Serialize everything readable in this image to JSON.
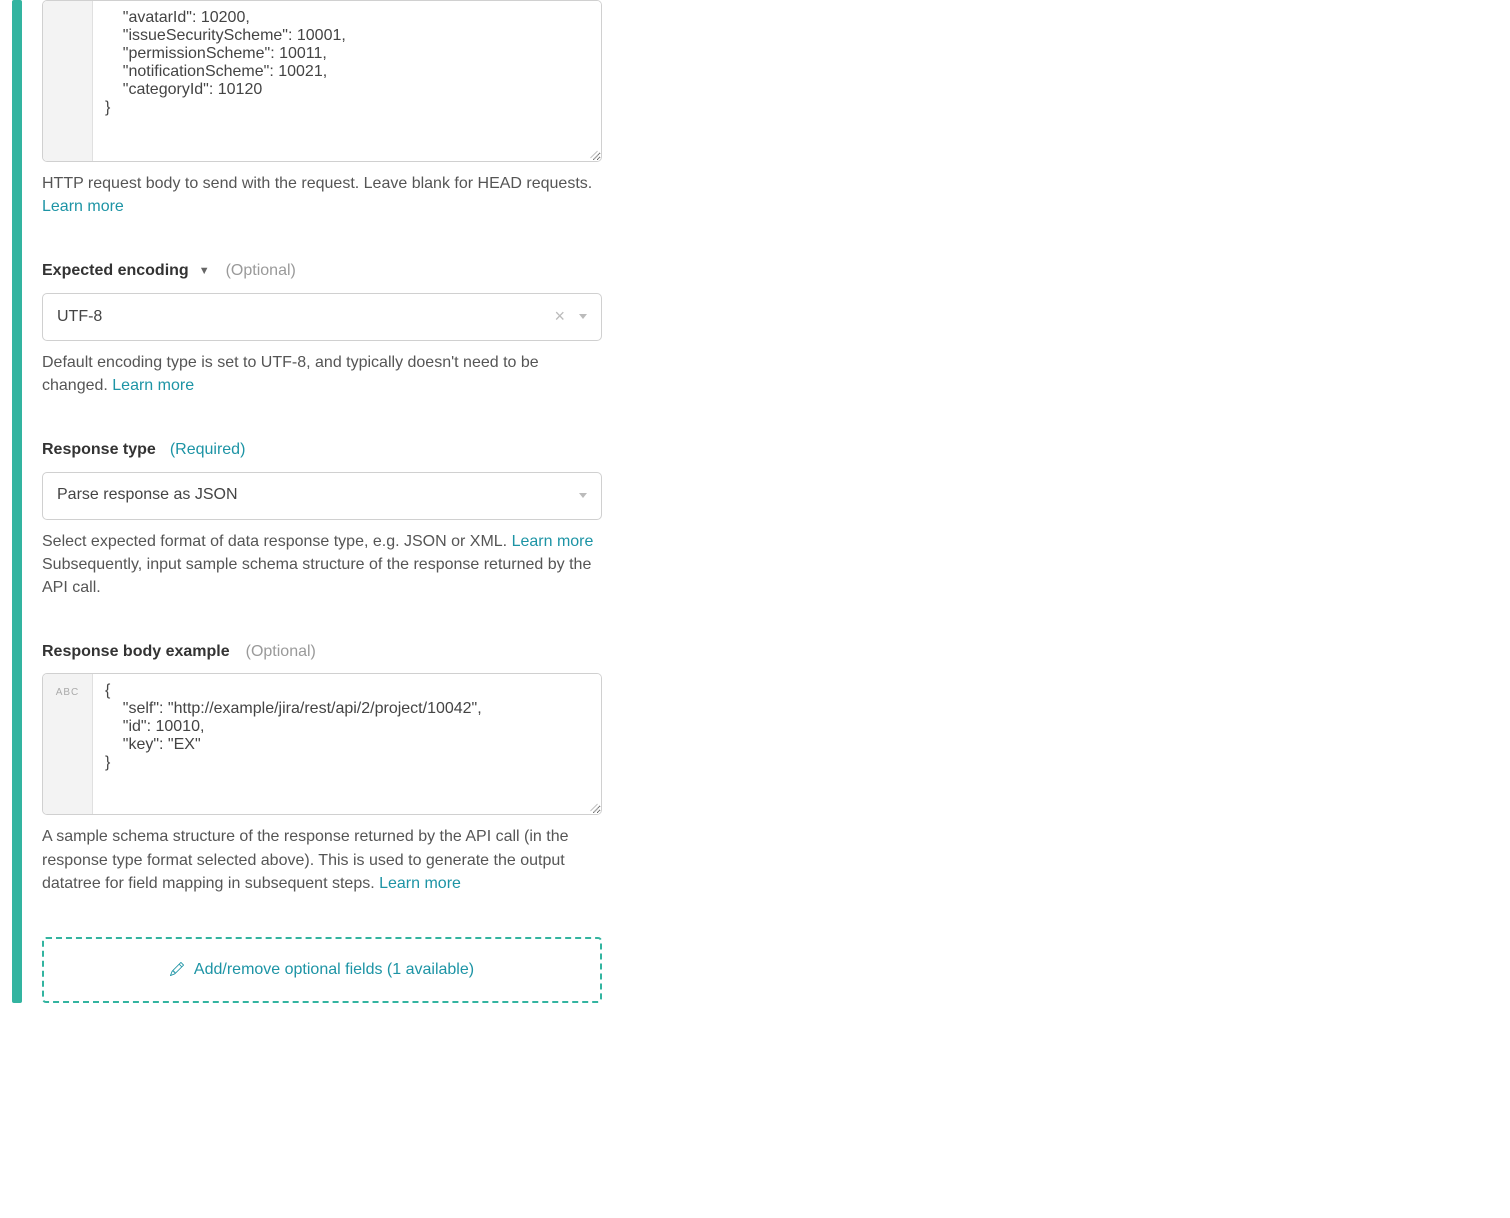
{
  "request_body": {
    "content": "    \"avatarId\": 10200,\n    \"issueSecurityScheme\": 10001,\n    \"permissionScheme\": 10011,\n    \"notificationScheme\": 10021,\n    \"categoryId\": 10120\n}",
    "help": "HTTP request body to send with the request. Leave blank for HEAD requests. ",
    "learn_more": "Learn more"
  },
  "expected_encoding": {
    "label": "Expected encoding",
    "optional": "(Optional)",
    "value": "UTF-8",
    "help": "Default encoding type is set to UTF-8, and typically doesn't need to be changed. ",
    "learn_more": "Learn more"
  },
  "response_type": {
    "label": "Response type",
    "required": "(Required)",
    "value": "Parse response as JSON",
    "help1": "Select expected format of data response type, e.g. JSON or XML. ",
    "learn_more": "Learn more",
    "help2": "Subsequently, input sample schema structure of the response returned by the API call."
  },
  "response_body_example": {
    "label": "Response body example",
    "optional": "(Optional)",
    "gutter": "ABC",
    "content": "{\n    \"self\": \"http://example/jira/rest/api/2/project/10042\",\n    \"id\": 10010,\n    \"key\": \"EX\"\n}",
    "help": "A sample schema structure of the response returned by the API call (in the response type format selected above). This is used to generate the output datatree for field mapping in subsequent steps. ",
    "learn_more": "Learn more"
  },
  "add_remove": {
    "label": "Add/remove optional fields (1 available)"
  }
}
